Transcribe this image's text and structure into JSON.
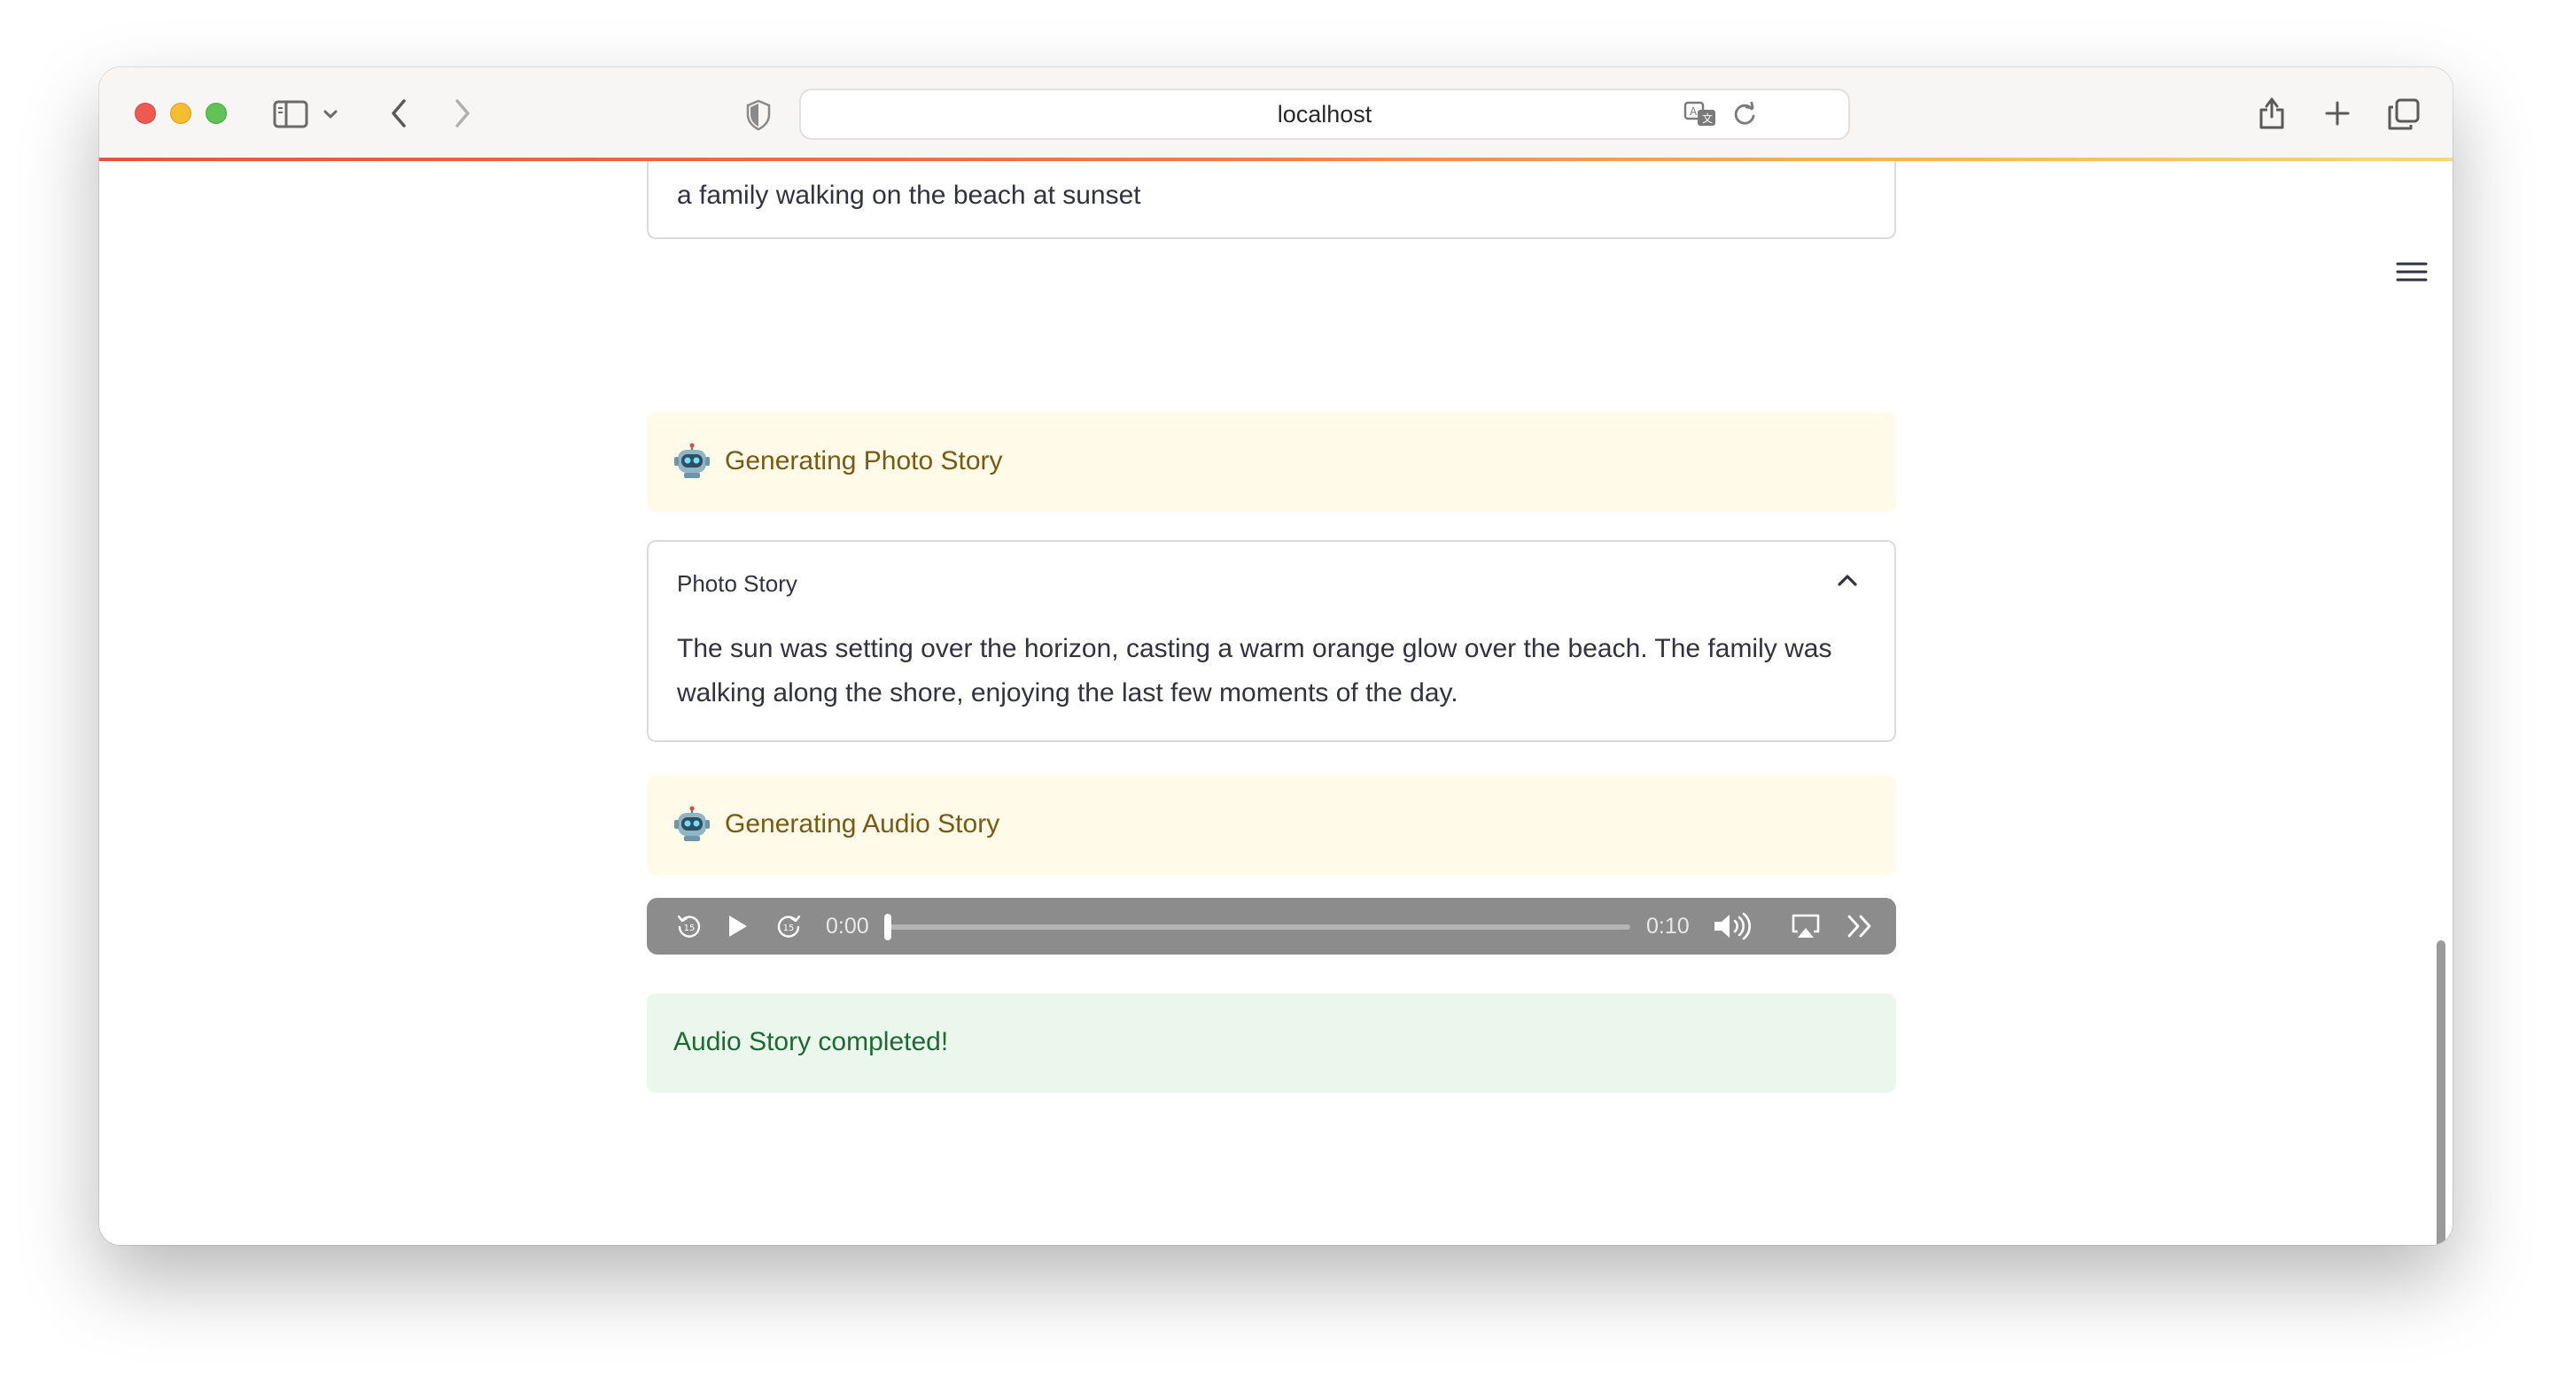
{
  "browser": {
    "url": "localhost",
    "icons": {
      "sidebar": "sidebar-icon",
      "chevron_down": "chevron-down-icon",
      "back": "back-arrow-icon",
      "forward": "forward-arrow-icon",
      "shield": "privacy-shield-icon",
      "translate": "translate-icon",
      "reload": "reload-icon",
      "share": "share-icon",
      "new_tab": "plus-icon",
      "tabs": "tab-overview-icon"
    }
  },
  "app": {
    "menu_icon": "hamburger-menu-icon",
    "prompt_text": "a family walking on the beach at sunset",
    "status_photo": {
      "icon": "robot-icon",
      "text": "Generating Photo Story"
    },
    "photo_story": {
      "title": "Photo Story",
      "expanded": true,
      "body": "The sun was setting over the horizon, casting a warm orange glow over the beach. The family was walking along the shore, enjoying the last few moments of the day."
    },
    "status_audio": {
      "icon": "robot-icon",
      "text": "Generating Audio Story"
    },
    "audio_player": {
      "current_time": "0:00",
      "duration": "0:10",
      "progress": 0,
      "skip_back_seconds": "15",
      "skip_forward_seconds": "15"
    },
    "success": {
      "text": "Audio Story completed!"
    }
  },
  "colors": {
    "info_bg": "#fffbe8",
    "info_text": "#7a5a10",
    "success_bg": "#ebf6ed",
    "success_text": "#1d6b33",
    "audio_bg": "#8c8c8c"
  }
}
